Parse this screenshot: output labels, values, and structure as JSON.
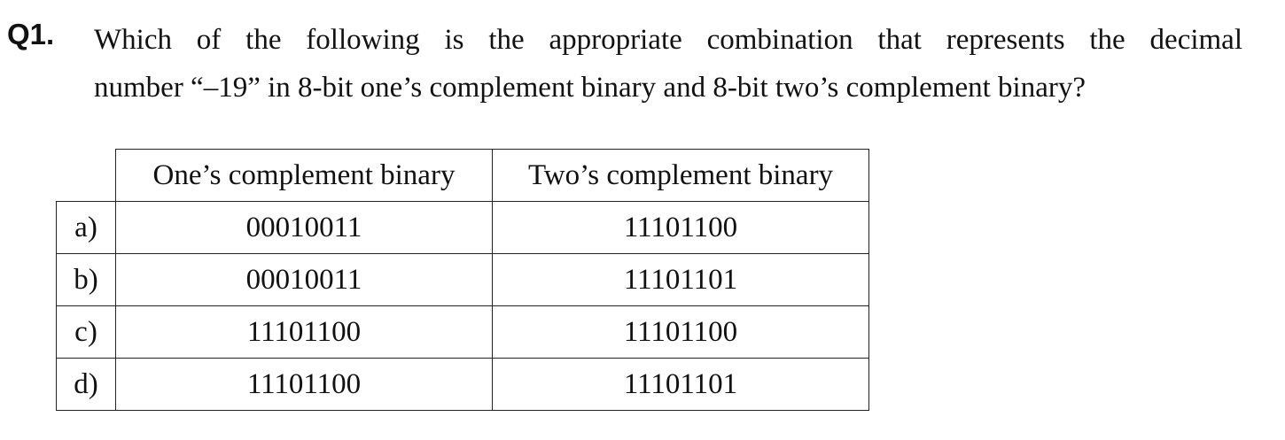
{
  "question": {
    "label": "Q1.",
    "text_line1": "Which of the following is the appropriate combination that represents the decimal",
    "text_line2": "number “–19” in 8-bit one’s complement binary and 8-bit two’s complement binary?"
  },
  "table": {
    "headers": [
      "One’s complement binary",
      "Two’s complement binary"
    ],
    "rows": [
      {
        "option": "a)",
        "ones": "00010011",
        "twos": "11101100"
      },
      {
        "option": "b)",
        "ones": "00010011",
        "twos": "11101101"
      },
      {
        "option": "c)",
        "ones": "11101100",
        "twos": "11101100"
      },
      {
        "option": "d)",
        "ones": "11101100",
        "twos": "11101101"
      }
    ]
  }
}
